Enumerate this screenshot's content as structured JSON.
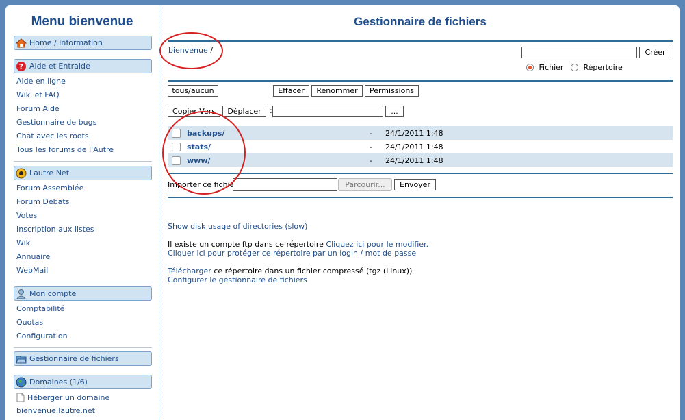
{
  "left": {
    "title": "Menu bienvenue",
    "home": "Home / Information",
    "aide": {
      "header": "Aide et Entraide",
      "items": [
        "Aide en ligne",
        "Wiki et FAQ",
        "Forum Aide",
        "Gestionnaire de bugs",
        "Chat avec les roots",
        "Tous les forums de l'Autre"
      ]
    },
    "net": {
      "header": "Lautre Net",
      "items": [
        "Forum Assemblée",
        "Forum Debats",
        "Votes",
        "Inscription aux listes",
        "Wiki",
        "Annuaire",
        "WebMail"
      ]
    },
    "compte": {
      "header": "Mon compte",
      "items": [
        "Comptabilité",
        "Quotas",
        "Configuration"
      ]
    },
    "gestion": "Gestionnaire de fichiers",
    "domaines": {
      "header": "Domaines (1/6)",
      "heberger": "Héberger un domaine",
      "domain": "bienvenue.lautre.net"
    }
  },
  "main": {
    "title": "Gestionnaire de fichiers",
    "breadcrumb_link": "bienvenue",
    "breadcrumb_sep": "/",
    "create_value": "",
    "create_button": "Créer",
    "radio_file": "Fichier",
    "radio_dir": "Répertoire",
    "buttons": {
      "toggle": "tous/aucun",
      "delete": "Effacer",
      "rename": "Renommer",
      "perms": "Permissions",
      "copy": "Copier Vers",
      "move": "Déplacer",
      "browse_dir": "..."
    },
    "dest_value": "",
    "dest_colon": ":",
    "files": [
      {
        "name": "backups/",
        "size": "-",
        "date": "24/1/2011 1:48"
      },
      {
        "name": "stats/",
        "size": "-",
        "date": "24/1/2011 1:48"
      },
      {
        "name": "www/",
        "size": "-",
        "date": "24/1/2011 1:48"
      }
    ],
    "import_label": "Importer ce fichier",
    "import_browse": "Parcourir...",
    "import_send": "Envoyer",
    "disk_usage": "Show disk usage of directories (slow)",
    "ftp_text": "Il existe un compte ftp dans ce répertoire",
    "ftp_link": "Cliquez ici pour le modifier.",
    "protect_link": "Cliquer ici pour protéger ce répertoire par un login / mot de passe",
    "download_link": "Télécharger",
    "download_text": "ce répertoire dans un fichier compressé (tgz (Linux))",
    "config_link": "Configurer le gestionnaire de fichiers"
  },
  "colors": {
    "background": "#5b87b8",
    "accent": "#1f4e8c",
    "row_shade": "#d6e4ef",
    "annotation": "#d42020"
  }
}
